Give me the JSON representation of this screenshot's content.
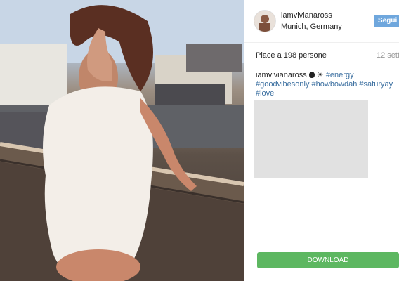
{
  "post": {
    "username": "iamvivianaross",
    "location": "Munich, Germany",
    "follow_label": "Segui",
    "likes_text": "Piace a 198 persone",
    "date": "12 sett",
    "caption": {
      "username": "iamvivianaross",
      "emoji": "☀",
      "tags": [
        "#energy",
        "#goodvibesonly",
        "#howbowdah",
        "#saturyay",
        "#love"
      ]
    }
  },
  "download_label": "DOWNLOAD",
  "colors": {
    "follow_button": "#6fa7dd",
    "download_button": "#5db761",
    "hashtag": "#3b6fa0",
    "placeholder": "#e1e1e1"
  },
  "icons": [
    "apple-emoji-icon",
    "sun-emoji-icon"
  ]
}
